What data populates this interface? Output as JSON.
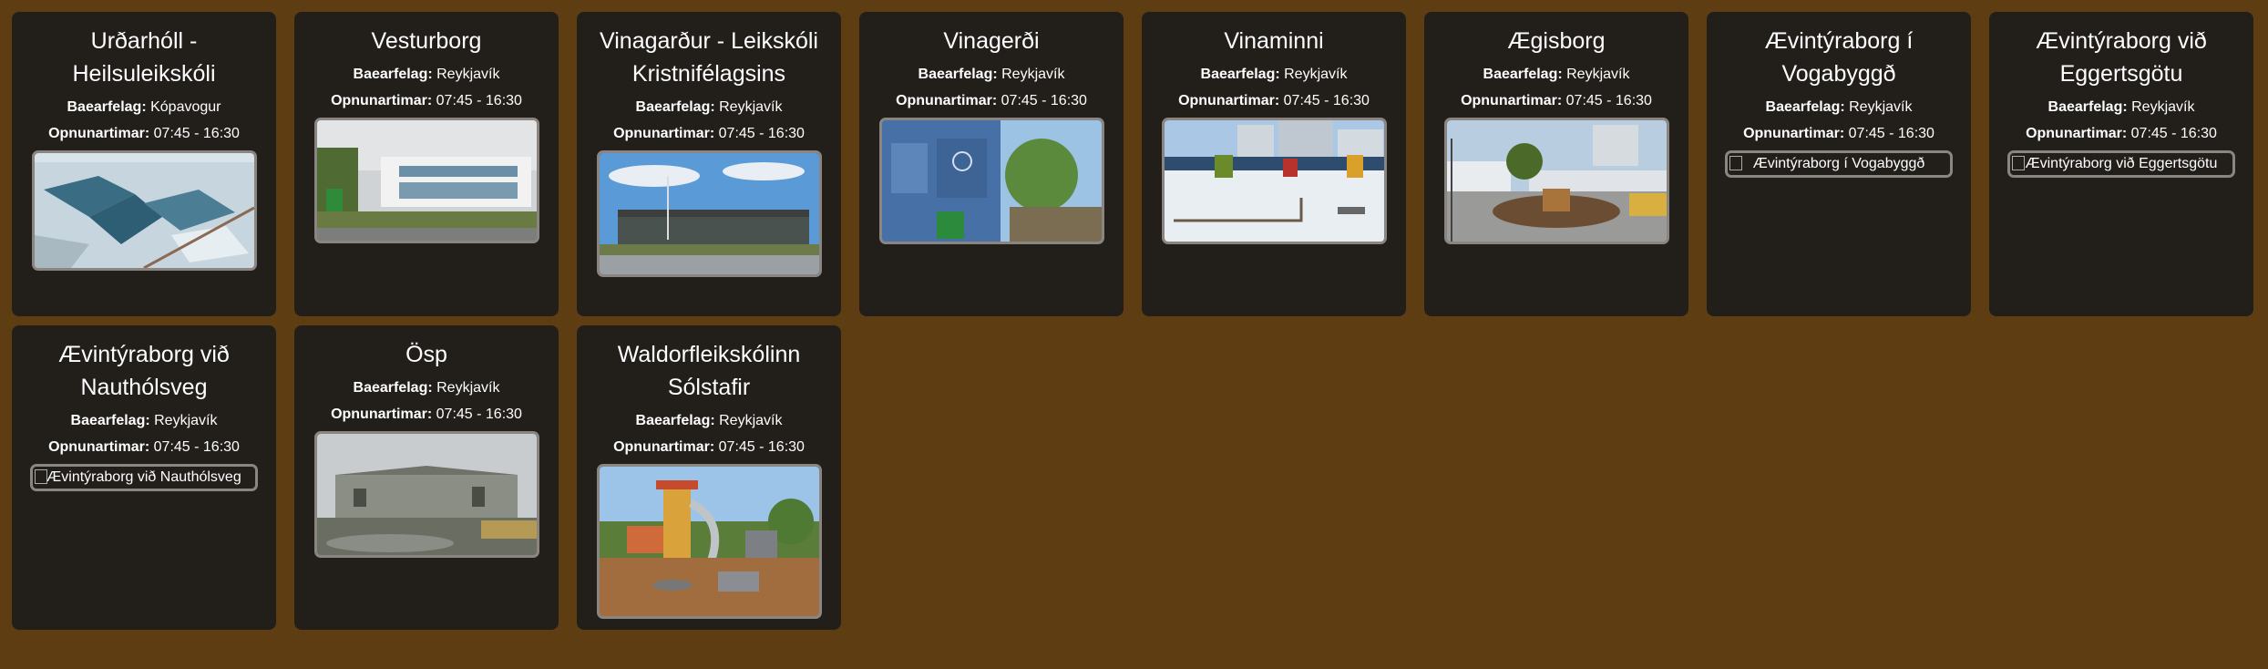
{
  "labels": {
    "municipality": "Baearfelag:",
    "hours": "Opnunartimar:"
  },
  "cards": [
    {
      "title": "Urðarhóll - Heilsuleikskóli",
      "municipality": "Kópavogur",
      "hours": "07:45 - 16:30",
      "image_alt": ""
    },
    {
      "title": "Vesturborg",
      "municipality": "Reykjavík",
      "hours": "07:45 - 16:30",
      "image_alt": ""
    },
    {
      "title": "Vinagarður - Leikskóli Kristnifélagsins",
      "municipality": "Reykjavík",
      "hours": "07:45 - 16:30",
      "image_alt": ""
    },
    {
      "title": "Vinagerði",
      "municipality": "Reykjavík",
      "hours": "07:45 - 16:30",
      "image_alt": ""
    },
    {
      "title": "Vinaminni",
      "municipality": "Reykjavík",
      "hours": "07:45 - 16:30",
      "image_alt": ""
    },
    {
      "title": "Ægisborg",
      "municipality": "Reykjavík",
      "hours": "07:45 - 16:30",
      "image_alt": ""
    },
    {
      "title": "Ævintýraborg í Vogabyggð",
      "municipality": "Reykjavík",
      "hours": "07:45 - 16:30",
      "image_alt": "Ævintýraborg í Vogabyggð"
    },
    {
      "title": "Ævintýraborg við Eggertsgötu",
      "municipality": "Reykjavík",
      "hours": "07:45 - 16:30",
      "image_alt": "Ævintýraborg við Eggertsgötu"
    },
    {
      "title": "Ævintýraborg við Nauthólsveg",
      "municipality": "Reykjavík",
      "hours": "07:45 - 16:30",
      "image_alt": "Ævintýraborg við Nauthólsveg"
    },
    {
      "title": "Ösp",
      "municipality": "Reykjavík",
      "hours": "07:45 - 16:30",
      "image_alt": ""
    },
    {
      "title": "Waldorfleikskólinn Sólstafir",
      "municipality": "Reykjavík",
      "hours": "07:45 - 16:30",
      "image_alt": ""
    }
  ]
}
